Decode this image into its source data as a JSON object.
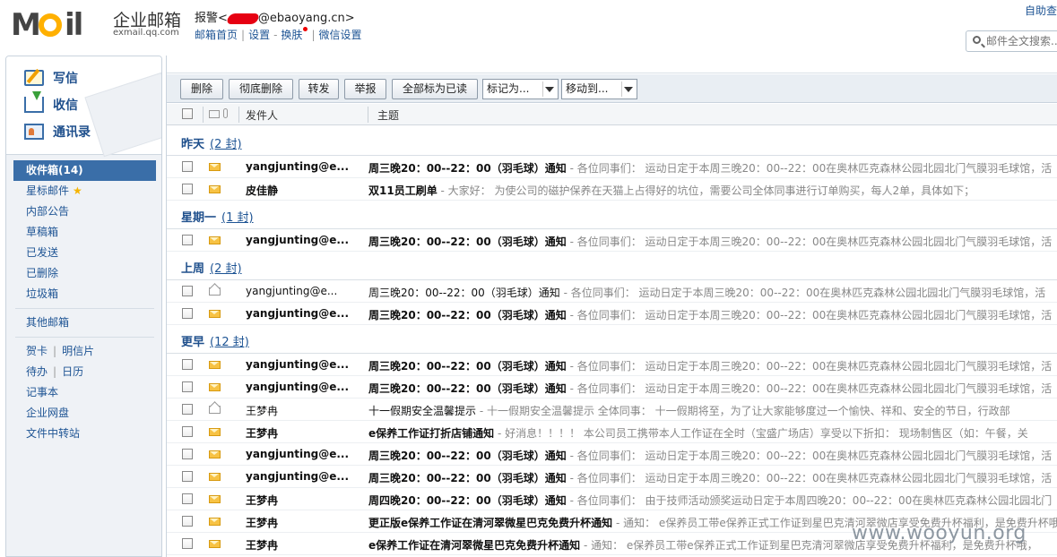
{
  "header": {
    "brand_name": "企业邮箱",
    "brand_sub": "exmail.qq.com",
    "logo_text": "Mail",
    "user_prefix": "报警<",
    "user_suffix": "@ebaoyang.cn>",
    "links": [
      "邮箱首页",
      "设置",
      "换肤",
      "微信设置"
    ],
    "auto_login": "自助查",
    "search_placeholder": "邮件全文搜索..."
  },
  "sidebar": {
    "quick": [
      {
        "label": "写信",
        "icon": "write-icon"
      },
      {
        "label": "收信",
        "icon": "inbox-download-icon"
      },
      {
        "label": "通讯录",
        "icon": "contacts-icon"
      }
    ],
    "folders": [
      "收件箱(14)",
      "星标邮件",
      "内部公告",
      "草稿箱",
      "已发送",
      "已删除",
      "垃圾箱"
    ],
    "other": "其他邮箱",
    "extra_pairs": [
      [
        "贺卡",
        "明信片"
      ],
      [
        "待办",
        "日历"
      ]
    ],
    "extra": [
      "记事本",
      "企业网盘",
      "文件中转站"
    ]
  },
  "toolbar": {
    "delete": "删除",
    "perm_delete": "彻底删除",
    "forward": "转发",
    "report": "举报",
    "mark_all_read": "全部标为已读",
    "mark_as": "标记为...",
    "move_to": "移动到..."
  },
  "columns": {
    "sender": "发件人",
    "subject": "主题"
  },
  "groups": [
    {
      "title": "昨天",
      "count": "(2 封)",
      "rows": [
        {
          "read": false,
          "sender": "yangjunting@e...",
          "subject": "周三晚20：00--22：00（羽毛球）通知",
          "preview": " - 各位同事们： 运动日定于本周三晚20：00--22：00在奥林匹克森林公园北园北门气膜羽毛球馆，活"
        },
        {
          "read": false,
          "sender": "皮佳静",
          "subject": "双11员工刷单",
          "preview": " - 大家好： 为使公司的磁护保养在天猫上占得好的坑位，需要公司全体同事进行订单购买，每人2单，具体如下；"
        }
      ]
    },
    {
      "title": "星期一",
      "count": "(1 封)",
      "rows": [
        {
          "read": false,
          "sender": "yangjunting@e...",
          "subject": "周三晚20：00--22：00（羽毛球）通知",
          "preview": " - 各位同事们： 运动日定于本周三晚20：00--22：00在奥林匹克森林公园北园北门气膜羽毛球馆，活"
        }
      ]
    },
    {
      "title": "上周",
      "count": "(2 封)",
      "rows": [
        {
          "read": true,
          "sender": "yangjunting@e...",
          "subject": "周三晚20：00--22：00（羽毛球）通知",
          "preview": " - 各位同事们： 运动日定于本周三晚20：00--22：00在奥林匹克森林公园北园北门气膜羽毛球馆，活"
        },
        {
          "read": false,
          "sender": "yangjunting@e...",
          "subject": "周三晚20：00--22：00（羽毛球）通知",
          "preview": " - 各位同事们： 运动日定于本周三晚20：00--22：00在奥林匹克森林公园北园北门气膜羽毛球馆，活"
        }
      ]
    },
    {
      "title": "更早",
      "count": "(12 封)",
      "rows": [
        {
          "read": false,
          "sender": "yangjunting@e...",
          "subject": "周三晚20：00--22：00（羽毛球）通知",
          "preview": " - 各位同事们： 运动日定于本周三晚20：00--22：00在奥林匹克森林公园北园北门气膜羽毛球馆，活"
        },
        {
          "read": false,
          "sender": "yangjunting@e...",
          "subject": "周三晚20：00--22：00（羽毛球）通知",
          "preview": " - 各位同事们： 运动日定于本周三晚20：00--22：00在奥林匹克森林公园北园北门气膜羽毛球馆，活"
        },
        {
          "read": true,
          "sender": "王梦冉",
          "subject": "十一假期安全温馨提示",
          "preview": " - 十一假期安全温馨提示 全体同事： 十一假期将至，为了让大家能够度过一个愉快、祥和、安全的节日，行政部"
        },
        {
          "read": false,
          "sender": "王梦冉",
          "subject": "e保养工作证打折店铺通知",
          "preview": " - 好消息！！！！ 本公司员工携带本人工作证在全时（宝盛广场店）享受以下折扣： 现场制售区（如：午餐，关"
        },
        {
          "read": false,
          "sender": "yangjunting@e...",
          "subject": "周三晚20：00--22：00（羽毛球）通知",
          "preview": " - 各位同事们： 运动日定于本周三晚20：00--22：00在奥林匹克森林公园北园北门气膜羽毛球馆，活"
        },
        {
          "read": false,
          "sender": "yangjunting@e...",
          "subject": "周三晚20：00--22：00（羽毛球）通知",
          "preview": " - 各位同事们： 运动日定于本周三晚20：00--22：00在奥林匹克森林公园北园北门气膜羽毛球馆，活"
        },
        {
          "read": false,
          "sender": "王梦冉",
          "subject": "周四晚20：00--22：00（羽毛球）通知",
          "preview": " - 各位同事们： 由于技师活动颁奖运动日定于本周四晚20：00--22：00在奥林匹克森林公园北园北门"
        },
        {
          "read": false,
          "sender": "王梦冉",
          "subject": "更正版e保养工作证在清河翠微星巴克免费升杯通知",
          "preview": " - 通知： e保养员工带e保养正式工作证到星巴克清河翠微店享受免费升杯福利，是免费升杯哦"
        },
        {
          "read": false,
          "sender": "王梦冉",
          "subject": "e保养工作证在清河翠微星巴克免费升杯通知",
          "preview": " - 通知： e保养员工带e保养正式工作证到星巴克清河翠微店享受免费升杯福利，是免费升杯哦，"
        }
      ]
    }
  ],
  "watermark": "www.wooyun.org",
  "colors": {
    "link": "#1e5494",
    "active_folder": "#3a6ea8",
    "unread_icon": "#f7c244",
    "redaction": "#e60012"
  }
}
